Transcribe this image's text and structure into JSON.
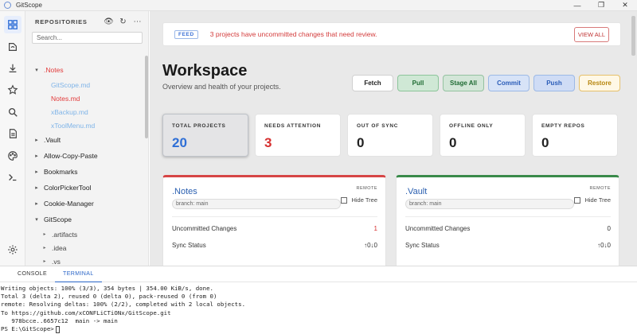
{
  "window": {
    "title": "GitScope",
    "controls": {
      "minimize": "—",
      "maximize": "❐",
      "close": "✕"
    }
  },
  "activity_bar": {
    "items": [
      {
        "icon": "dashboard-icon",
        "active": true
      },
      {
        "icon": "source-control-icon",
        "active": false
      },
      {
        "icon": "download-icon",
        "active": false
      },
      {
        "icon": "star-icon",
        "active": false
      },
      {
        "icon": "search-icon",
        "active": false
      },
      {
        "icon": "document-icon",
        "active": false
      },
      {
        "icon": "palette-icon",
        "active": false
      },
      {
        "icon": "terminal-icon",
        "active": false
      },
      {
        "icon": "settings-icon",
        "active": false
      }
    ]
  },
  "sidebar": {
    "title": "REPOSITORIES",
    "actions": {
      "view": "👁",
      "refresh": "↻",
      "more": "⋯"
    },
    "search_placeholder": "Search...",
    "tree": {
      "notes": {
        "label": ".Notes",
        "caret": "▾",
        "children": [
          {
            "label": "GitScope.md",
            "color": "blue"
          },
          {
            "label": "Notes.md",
            "color": "red"
          },
          {
            "label": "xBackup.md",
            "color": "blue"
          },
          {
            "label": "xToolMenu.md",
            "color": "blue"
          }
        ]
      },
      "repos": [
        {
          "label": ".Vault",
          "caret": "▸"
        },
        {
          "label": "Allow-Copy-Paste",
          "caret": "▸"
        },
        {
          "label": "Bookmarks",
          "caret": "▸"
        },
        {
          "label": "ColorPickerTool",
          "caret": "▸"
        },
        {
          "label": "Cookie-Manager",
          "caret": "▸"
        }
      ],
      "gitscope": {
        "label": "GitScope",
        "caret": "▾",
        "children": [
          {
            "label": ".artifacts",
            "caret": "▸"
          },
          {
            "label": ".idea",
            "caret": "▸"
          },
          {
            "label": ".vs",
            "caret": "▸"
          }
        ]
      }
    }
  },
  "main": {
    "feed": {
      "badge": "FEED",
      "message": "3 projects have uncommitted changes that need review.",
      "button": "VIEW ALL"
    },
    "title": "Workspace",
    "subtitle": "Overview and health of your projects.",
    "actions": {
      "fetch": "Fetch",
      "pull": "Pull",
      "stage_all": "Stage All",
      "commit": "Commit",
      "push": "Push",
      "restore": "Restore"
    },
    "stats": [
      {
        "label": "TOTAL PROJECTS",
        "value": "20"
      },
      {
        "label": "NEEDS ATTENTION",
        "value": "3"
      },
      {
        "label": "OUT OF SYNC",
        "value": "0"
      },
      {
        "label": "OFFLINE ONLY",
        "value": "0"
      },
      {
        "label": "EMPTY REPOS",
        "value": "0"
      }
    ],
    "repos": [
      {
        "name": ".Notes",
        "remote": "REMOTE",
        "branch": "branch: main",
        "hide_tree": "Hide Tree",
        "uncommitted_label": "Uncommitted Changes",
        "uncommitted_value": "1",
        "sync_label": "Sync Status",
        "sync_value": "↑0↓0",
        "accent": "#d64545"
      },
      {
        "name": ".Vault",
        "remote": "REMOTE",
        "branch": "branch: main",
        "hide_tree": "Hide Tree",
        "uncommitted_label": "Uncommitted Changes",
        "uncommitted_value": "0",
        "sync_label": "Sync Status",
        "sync_value": "↑0↓0",
        "accent": "#3a8a4a"
      }
    ]
  },
  "panel": {
    "tabs": {
      "console": "CONSOLE",
      "terminal": "TERMINAL"
    },
    "terminal_lines": [
      "Writing objects: 100% (3/3), 354 bytes | 354.00 KiB/s, done.",
      "Total 3 (delta 2), reused 0 (delta 0), pack-reused 0 (from 0)",
      "remote: Resolving deltas: 100% (2/2), completed with 2 local objects.",
      "To https://github.com/xCONFLiCTiONx/GitScope.git",
      "   978bcce..6657c12  main -> main"
    ],
    "prompt": "PS E:\\GitScope>"
  }
}
